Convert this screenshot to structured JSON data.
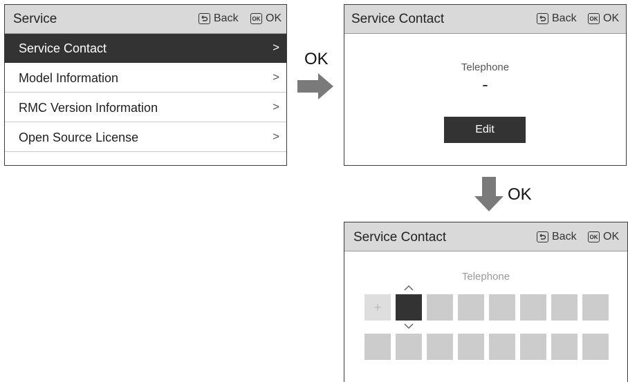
{
  "hotkeys": {
    "back_label": "Back",
    "ok_label": "OK",
    "ok_icon_text": "OK"
  },
  "screen1": {
    "title": "Service",
    "items": [
      {
        "label": "Service Contact",
        "selected": true
      },
      {
        "label": "Model Information",
        "selected": false
      },
      {
        "label": "RMC Version Information",
        "selected": false
      },
      {
        "label": "Open Source License",
        "selected": false
      }
    ],
    "chevron": ">"
  },
  "transition1": {
    "label": "OK"
  },
  "screen2": {
    "title": "Service Contact",
    "telephone_label": "Telephone",
    "telephone_value": "-",
    "edit_label": "Edit"
  },
  "transition2": {
    "label": "OK"
  },
  "screen3": {
    "title": "Service Contact",
    "telephone_label": "Telephone",
    "plus_symbol": "+",
    "up_symbol": "^",
    "down_symbol": "v"
  },
  "colors": {
    "titlebar": "#d9d9d9",
    "selected": "#333333",
    "cell": "#cccccc",
    "arrow": "#7a7a7a"
  }
}
